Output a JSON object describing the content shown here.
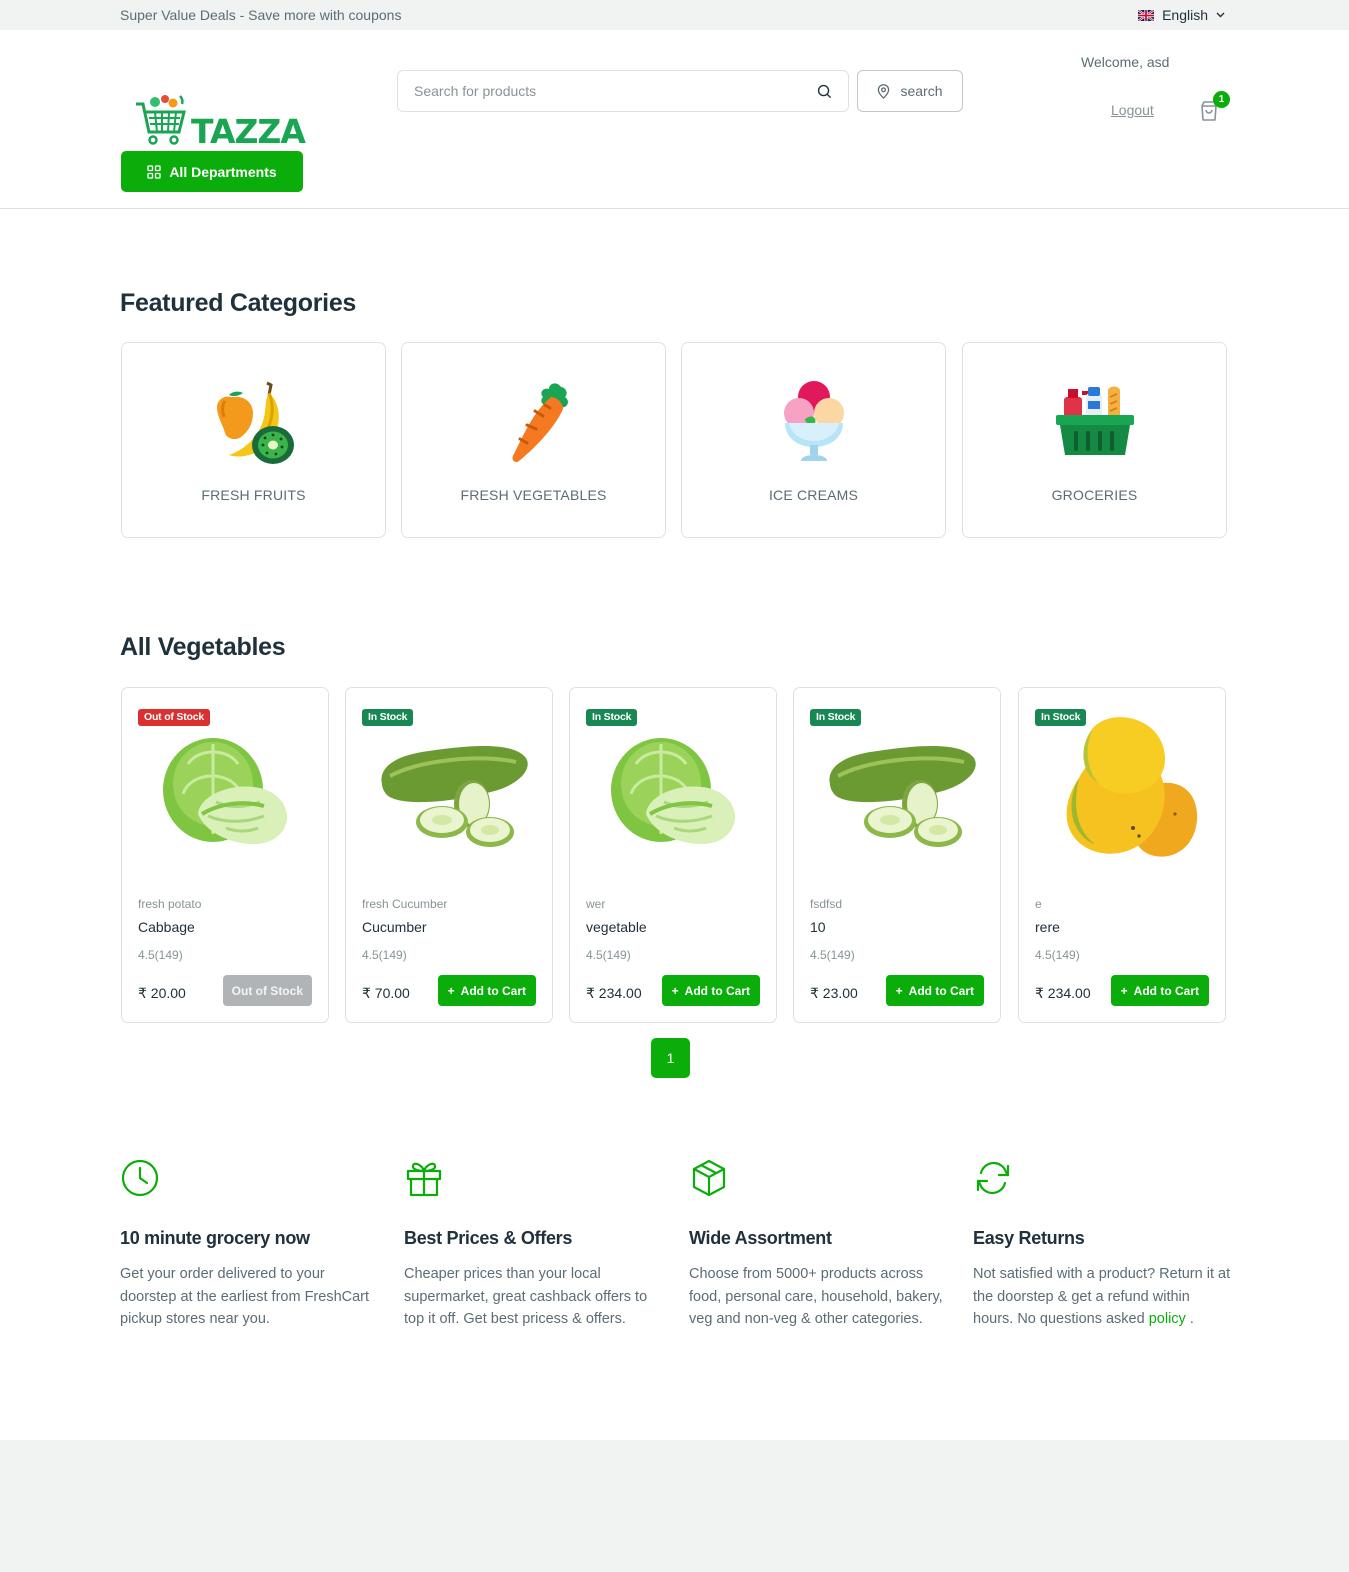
{
  "topbar": {
    "promo": "Super Value Deals - Save more with coupons",
    "language": "English"
  },
  "header": {
    "logo_text": "TAZZA",
    "search_placeholder": "Search for products",
    "location_button": "search",
    "welcome": "Welcome, asd",
    "logout": "Logout",
    "cart_count": "1",
    "departments_button": "All Departments"
  },
  "featured": {
    "title": "Featured Categories",
    "categories": [
      {
        "label": "FRESH FRUITS",
        "icon": "fruits-icon"
      },
      {
        "label": "FRESH VEGETABLES",
        "icon": "carrot-icon"
      },
      {
        "label": "ICE CREAMS",
        "icon": "ice-cream-icon"
      },
      {
        "label": "GROCERIES",
        "icon": "grocery-basket-icon"
      }
    ]
  },
  "products": {
    "title": "All Vegetables",
    "items": [
      {
        "badge": "Out of Stock",
        "category": "fresh potato",
        "name": "Cabbage",
        "rating": "4.5(149)",
        "price": "₹ 20.00",
        "button": "Out of Stock",
        "image": "cabbage"
      },
      {
        "badge": "In Stock",
        "category": "fresh Cucumber",
        "name": "Cucumber",
        "rating": "4.5(149)",
        "price": "₹ 70.00",
        "button": "Add to Cart",
        "image": "cucumber"
      },
      {
        "badge": "In Stock",
        "category": "wer",
        "name": "vegetable",
        "rating": "4.5(149)",
        "price": "₹ 234.00",
        "button": "Add to Cart",
        "image": "cabbage"
      },
      {
        "badge": "In Stock",
        "category": "fsdfsd",
        "name": "10",
        "rating": "4.5(149)",
        "price": "₹ 23.00",
        "button": "Add to Cart",
        "image": "cucumber"
      },
      {
        "badge": "In Stock",
        "category": "e",
        "name": "rere",
        "rating": "4.5(149)",
        "price": "₹ 234.00",
        "button": "Add to Cart",
        "image": "mango"
      }
    ],
    "page": "1"
  },
  "features": [
    {
      "icon": "clock-icon",
      "title": "10 minute grocery now",
      "text": "Get your order delivered to your doorstep at the earliest from FreshCart pickup stores near you."
    },
    {
      "icon": "gift-icon",
      "title": "Best Prices & Offers",
      "text": "Cheaper prices than your local supermarket, great cashback offers to top it off. Get best pricess & offers."
    },
    {
      "icon": "box-icon",
      "title": "Wide Assortment",
      "text": "Choose from 5000+ products across food, personal care, household, bakery, veg and non-veg & other categories."
    },
    {
      "icon": "refresh-icon",
      "title": "Easy Returns",
      "text": "Not satisfied with a product? Return it at the doorstep & get a refund within hours. No questions asked",
      "link": "policy",
      "link_suffix": " ."
    }
  ],
  "colors": {
    "primary": "#0aad0a",
    "danger": "#db3030",
    "in_stock": "#198754",
    "text": "#21313c",
    "muted": "#5c6c75"
  }
}
